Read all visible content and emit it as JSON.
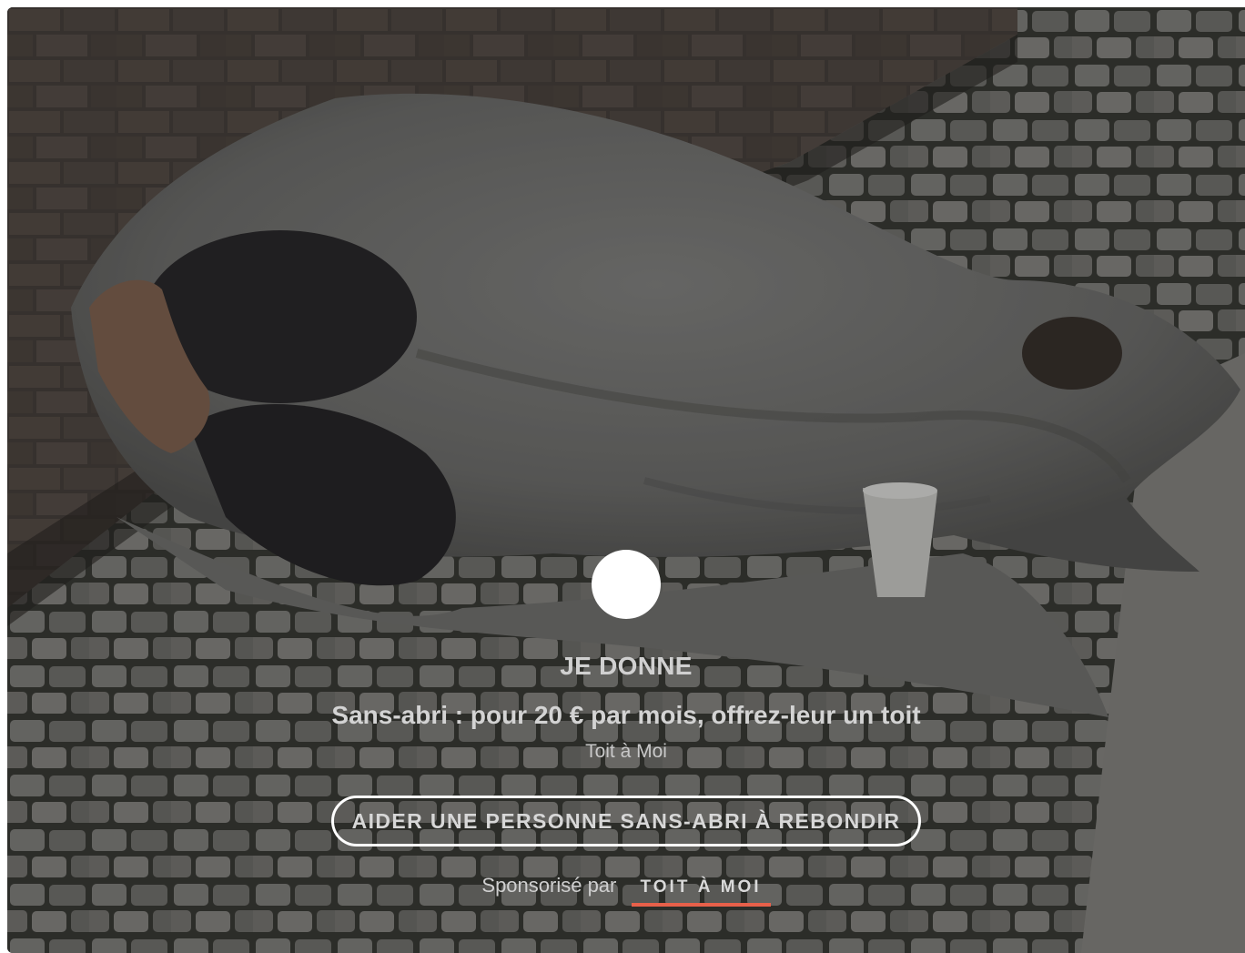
{
  "ad": {
    "kicker": "JE DONNE",
    "headline": "Sans-abri : pour 20 € par mois, offrez-leur un toit",
    "advertiser": "Toit à Moi",
    "cta_label": "AIDER UNE PERSONNE SANS-ABRI À REBONDIR",
    "sponsored_label": "Sponsorisé par",
    "sponsor_name": "TOIT À MOI"
  },
  "colors": {
    "sponsor_underline": "#e8604a",
    "play_button": "#ffffff",
    "overlay": "rgba(0,0,0,0.28)"
  },
  "icons": {
    "play": "play-button-circle"
  }
}
